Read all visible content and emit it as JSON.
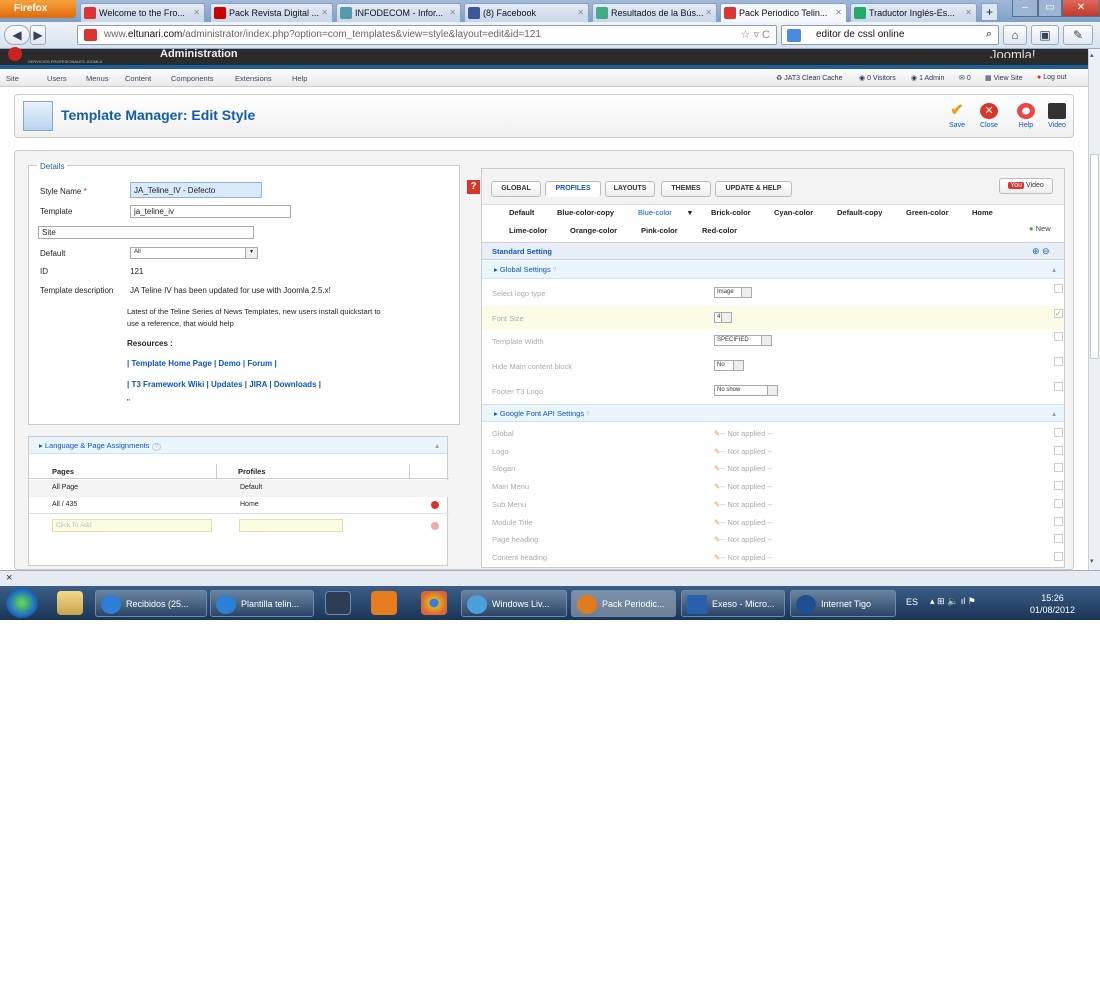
{
  "browser": {
    "menu_button": "Firefox",
    "tabs": [
      {
        "title": "Welcome to the Fro...",
        "icon_color": "#d33"
      },
      {
        "title": "Pack Revista Digital ...",
        "icon_color": "#c00"
      },
      {
        "title": "INFODECOM - Infor...",
        "icon_color": "#59a"
      },
      {
        "title": "(8) Facebook",
        "icon_color": "#3b5998"
      },
      {
        "title": "Resultados de la Bús...",
        "icon_color": "#4a8"
      },
      {
        "title": "Pack Periodico Telin...",
        "icon_color": "#d33"
      },
      {
        "title": "Traductor Inglés-Es...",
        "icon_color": "#2a6"
      }
    ],
    "new_tab": "+",
    "url_prefix": "www.",
    "url_domain": "eltunari.com",
    "url_path": "/administrator/index.php?option=com_templates&view=style&layout=edit&id=121",
    "search_text": "editor de cssl online"
  },
  "joomla": {
    "header_text": "SERVICIOS PROFESIONALES JOOMLA",
    "header_title": "Administration",
    "header_logo": "Joomla!",
    "menu": [
      "Site",
      "Users",
      "Menus",
      "Content",
      "Components",
      "Extensions",
      "Help"
    ],
    "status": [
      "JAT3 Clean Cache",
      "0 Visitors",
      "1 Admin",
      "0",
      "View Site",
      "Log out"
    ],
    "page_title": "Template Manager: Edit Style",
    "toolbar": [
      "Save",
      "Close",
      "Help",
      "Video"
    ]
  },
  "details": {
    "legend": "Details",
    "style_name_label": "Style Name",
    "required_mark": "*",
    "style_name_value": "JA_Teline_IV - Defecto",
    "template_label": "Template",
    "template_value": "ja_teline_iv",
    "site_value": "Site",
    "default_label": "Default",
    "default_value": "All",
    "id_label": "ID",
    "id_value": "121",
    "desc_label": "Template description",
    "desc_line1": "JA Teline IV has been updated for use with Joomla 2.5.x!",
    "desc_line2": "Latest of the Teline Series of News Templates, new users install quickstart to",
    "desc_line3": "use a reference, that would help",
    "resources": "Resources :",
    "links1": "| Template Home Page | Demo | Forum |",
    "links2": "| T3 Framework Wiki | Updates | JIRA | Downloads |",
    "quote": "\""
  },
  "assignments": {
    "title": "Language & Page Assignments",
    "help": "?",
    "col_pages": "Pages",
    "col_profiles": "Profiles",
    "rows": [
      {
        "page": "All Page",
        "profile": "Default"
      },
      {
        "page": "All / 435",
        "profile": "Home"
      }
    ],
    "add_placeholder": "Click To Add"
  },
  "right": {
    "tabs": [
      "GLOBAL",
      "PROFILES",
      "LAYOUTS",
      "THEMES",
      "UPDATE & HELP"
    ],
    "video_btn": "Video",
    "youtube": "You",
    "profiles_row1": [
      "Default",
      "Blue-color-copy",
      "Blue-color",
      "Brick-color",
      "Cyan-color",
      "Default-copy",
      "Green-color",
      "Home"
    ],
    "profiles_row2": [
      "Lime-color",
      "Orange-color",
      "Pink-color",
      "Red-color"
    ],
    "new_label": "New",
    "standard_setting": "Standard Setting",
    "global_settings": "Global Settings",
    "global_rows": [
      {
        "name": "Select logo type",
        "value": "Image"
      },
      {
        "name": "Font Size",
        "value": "4"
      },
      {
        "name": "Template Width",
        "value": "SPECIFIED"
      },
      {
        "name": "Hide Main content block",
        "value": "No"
      },
      {
        "name": "Footer T3 Logo",
        "value": "No show"
      }
    ],
    "google_font": "Google Font API Settings",
    "font_rows": [
      "Global",
      "Logo",
      "Slogan",
      "Main Menu",
      "Sub Menu",
      "Module Title",
      "Page heading",
      "Content heading"
    ],
    "not_applied": "-- Not applied --"
  },
  "taskbar": {
    "apps": [
      "Recibidos (25...",
      "Plantilla telin...",
      "Windows Liv...",
      "Pack Periodic...",
      "Exeso - Micro...",
      "Internet Tigo"
    ],
    "lang": "ES",
    "time": "15:26",
    "date": "01/08/2012"
  },
  "close_x": "×"
}
